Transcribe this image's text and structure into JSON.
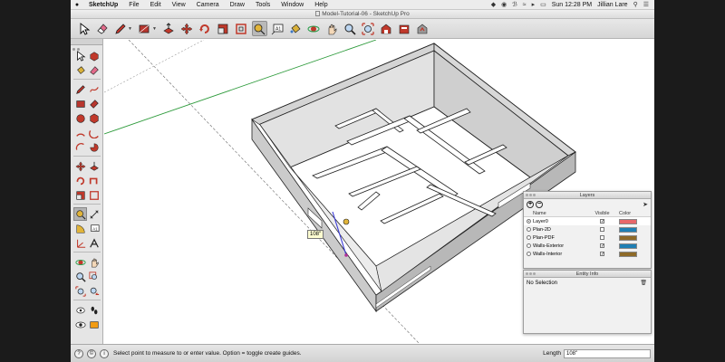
{
  "menubar": {
    "apple_icon": "apple-icon",
    "items": [
      "SketchUp",
      "File",
      "Edit",
      "View",
      "Camera",
      "Draw",
      "Tools",
      "Window",
      "Help"
    ],
    "clock": "Sun 12:28 PM",
    "user": "Jillian Lare"
  },
  "window": {
    "title": "Model-Tutorial-06 - SketchUp Pro"
  },
  "toolbar": {
    "tools": [
      "select-icon",
      "eraser-icon",
      "pencil-icon",
      "rectangle-icon",
      "push-pull-icon",
      "move-icon",
      "rotate-icon",
      "scale-icon",
      "offset-icon",
      "tape-measure-icon",
      "text-icon",
      "paint-bucket-icon",
      "orbit-icon",
      "pan-icon",
      "zoom-icon",
      "zoom-extents-icon",
      "warehouse-icon",
      "extension-icon",
      "share-icon"
    ],
    "active_tool": "tape-measure-icon"
  },
  "viewport": {
    "tooltip": "108\""
  },
  "layers_panel": {
    "title": "Layers",
    "add_label": "+",
    "remove_label": "−",
    "columns": {
      "name": "Name",
      "visible": "Visible",
      "color": "Color"
    },
    "rows": [
      {
        "name": "Layer0",
        "active": true,
        "visible": true,
        "color": "#e8686b"
      },
      {
        "name": "Plan-2D",
        "active": false,
        "visible": false,
        "color": "#1f7fb4"
      },
      {
        "name": "Plan-PDF",
        "active": false,
        "visible": false,
        "color": "#8e6a28"
      },
      {
        "name": "Walls-Exterior",
        "active": false,
        "visible": true,
        "color": "#1f7fb4"
      },
      {
        "name": "Walls-Interior",
        "active": false,
        "visible": true,
        "color": "#8e6a28"
      }
    ]
  },
  "entity_info": {
    "title": "Entity Info",
    "selection": "No Selection"
  },
  "statusbar": {
    "message": "Select point to measure to or enter value. Option = toggle create guides.",
    "length_label": "Length",
    "length_value": "108\""
  }
}
